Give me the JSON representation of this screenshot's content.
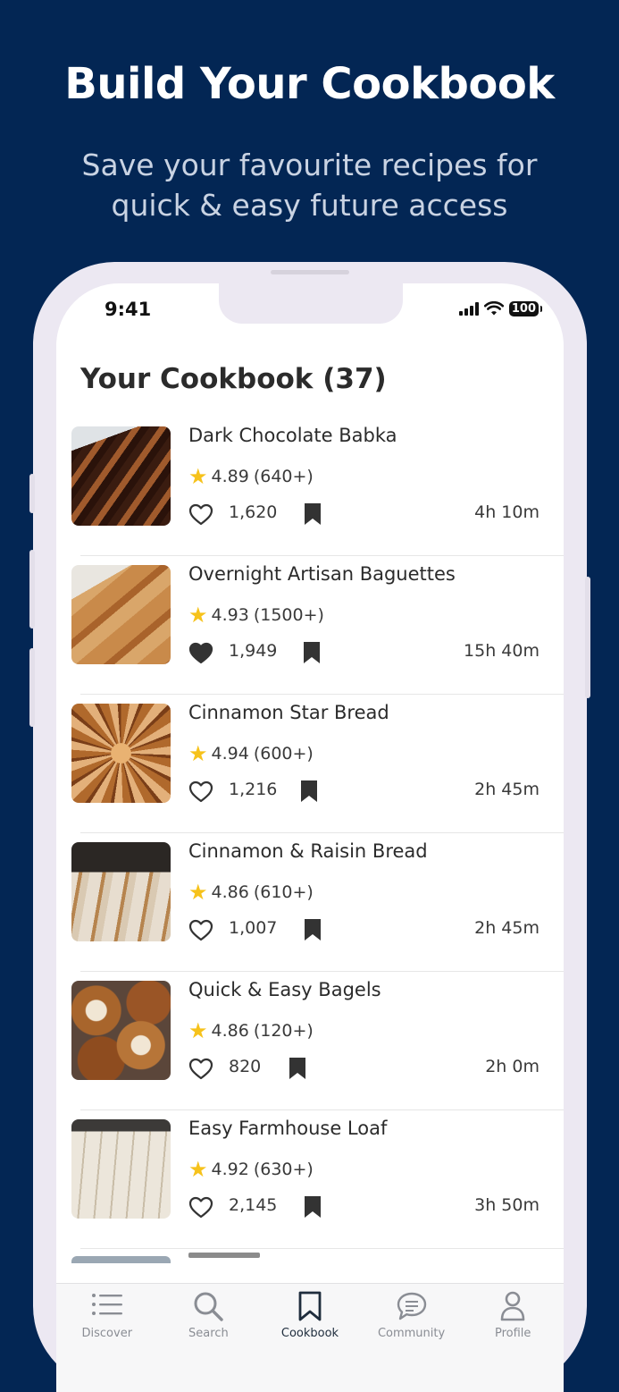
{
  "promo": {
    "title": "Build Your Cookbook",
    "subtitle": "Save your favourite recipes for quick & easy future access"
  },
  "status_bar": {
    "time": "9:41",
    "battery": "100"
  },
  "page": {
    "title": "Your Cookbook (37)"
  },
  "recipes": [
    {
      "name": "Dark Chocolate Babka",
      "rating": "4.89",
      "rating_count": "(640+)",
      "likes": "1,620",
      "duration": "4h 10m",
      "liked": false
    },
    {
      "name": "Overnight Artisan Baguettes",
      "rating": "4.93",
      "rating_count": "(1500+)",
      "likes": "1,949",
      "duration": "15h 40m",
      "liked": true
    },
    {
      "name": "Cinnamon Star Bread",
      "rating": "4.94",
      "rating_count": "(600+)",
      "likes": "1,216",
      "duration": "2h 45m",
      "liked": false
    },
    {
      "name": "Cinnamon & Raisin Bread",
      "rating": "4.86",
      "rating_count": "(610+)",
      "likes": "1,007",
      "duration": "2h 45m",
      "liked": false
    },
    {
      "name": "Quick & Easy Bagels",
      "rating": "4.86",
      "rating_count": "(120+)",
      "likes": "820",
      "duration": "2h 0m",
      "liked": false
    },
    {
      "name": "Easy Farmhouse Loaf",
      "rating": "4.92",
      "rating_count": "(630+)",
      "likes": "2,145",
      "duration": "3h 50m",
      "liked": false
    }
  ],
  "tabs": [
    {
      "label": "Discover",
      "icon": "list-icon"
    },
    {
      "label": "Search",
      "icon": "search-icon"
    },
    {
      "label": "Cookbook",
      "icon": "bookmark-icon",
      "active": true
    },
    {
      "label": "Community",
      "icon": "chat-icon"
    },
    {
      "label": "Profile",
      "icon": "person-icon"
    }
  ],
  "colors": {
    "background": "#032654",
    "star": "#f6c21b",
    "active_tab": "#1f2d3d",
    "inactive_tab": "#8a8d94"
  }
}
